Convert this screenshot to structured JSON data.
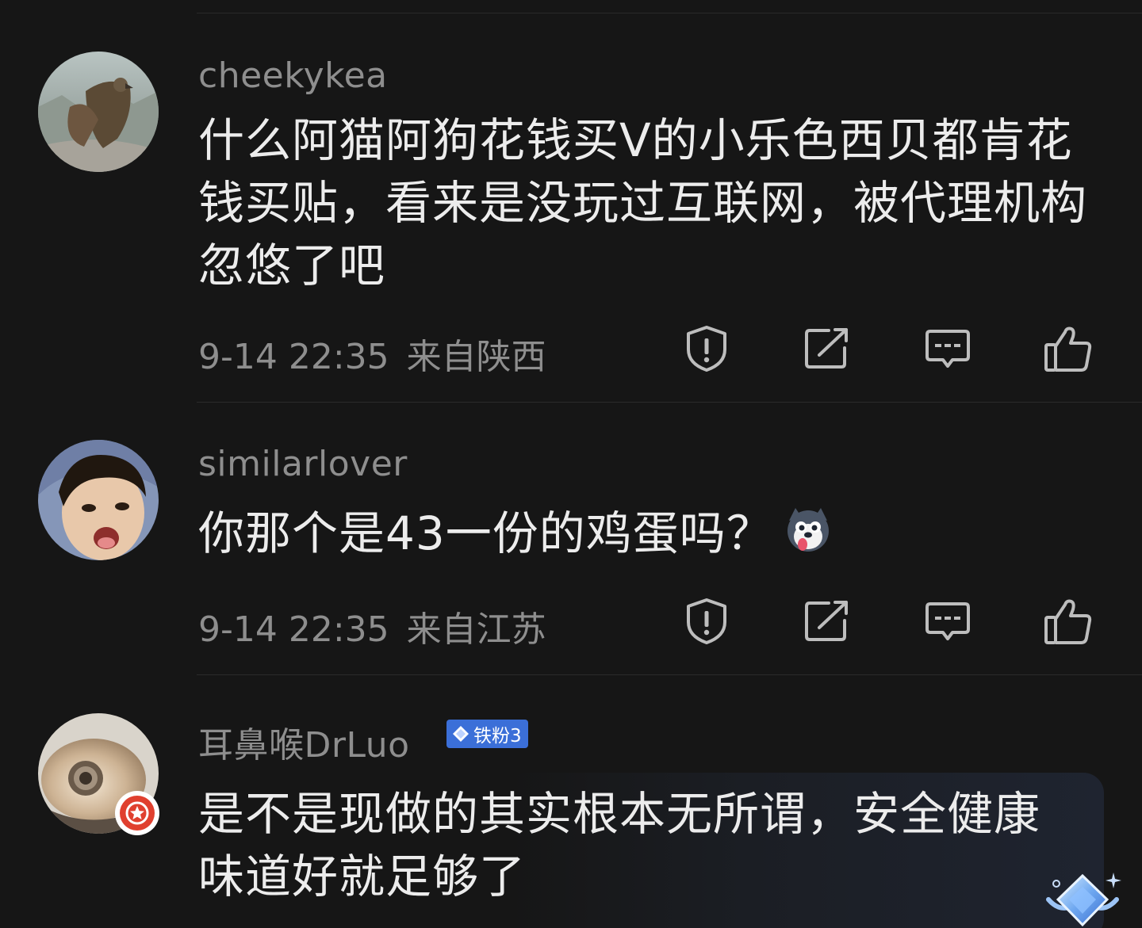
{
  "comments": [
    {
      "username": "cheekykea",
      "text": "什么阿猫阿狗花钱买V的小乐色西贝都肯花钱买贴，看来是没玩过互联网，被代理机构忽悠了吧",
      "time": "9-14 22:35",
      "location": "来自陕西"
    },
    {
      "username": "similarlover",
      "text": "你那个是43一份的鸡蛋吗？",
      "time": "9-14 22:35",
      "location": "来自江苏"
    },
    {
      "username": "耳鼻喉DrLuo",
      "badge": "铁粉3",
      "text": "是不是现做的其实根本无所谓，安全健康味道好就足够了"
    }
  ],
  "colors": {
    "background": "#161616",
    "username": "#8e8e8e",
    "text": "#ececec",
    "badge": "#3b6fd8",
    "verified": "#e0402f"
  },
  "icons": [
    "report-icon",
    "share-icon",
    "reply-icon",
    "like-icon",
    "husky-emoji",
    "verified-badge-icon",
    "diamond-icon"
  ]
}
